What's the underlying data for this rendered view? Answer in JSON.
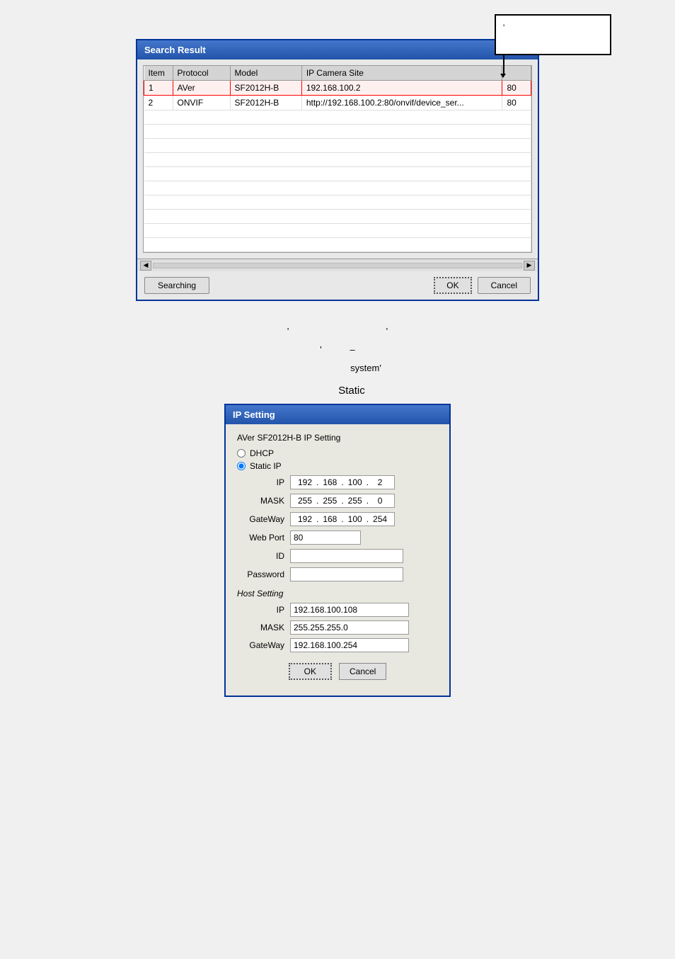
{
  "page": {
    "title": "Search Result and IP Setting UI"
  },
  "callout": {
    "text": "'"
  },
  "search_dialog": {
    "title": "Search Result",
    "columns": [
      "Item",
      "Protocol",
      "Model",
      "IP Camera Site",
      ""
    ],
    "rows": [
      {
        "item": "1",
        "protocol": "AVer",
        "model": "SF2012H-B",
        "ip": "192.168.100.2",
        "port": "80",
        "selected": true
      },
      {
        "item": "2",
        "protocol": "ONVIF",
        "model": "SF2012H-B",
        "ip": "http://192.168.100.2:80/onvif/device_ser...",
        "port": "80",
        "selected": false
      }
    ],
    "empty_rows": 10,
    "searching_btn": "Searching",
    "ok_btn": "OK",
    "cancel_btn": "Cancel"
  },
  "middle_text": {
    "line1": "' , '",
    "line2": "' –",
    "line3": "system'"
  },
  "static_text": "Static",
  "ip_dialog": {
    "title": "IP Setting",
    "device_label": "AVer SF2012H-B IP Setting",
    "dhcp_label": "DHCP",
    "static_ip_label": "Static IP",
    "static_ip_selected": true,
    "ip_label": "IP",
    "ip_octets": [
      "192",
      "168",
      "100",
      "2"
    ],
    "mask_label": "MASK",
    "mask_octets": [
      "255",
      "255",
      "255",
      "0"
    ],
    "gateway_label": "GateWay",
    "gateway_octets": [
      "192",
      "168",
      "100",
      "254"
    ],
    "webport_label": "Web Port",
    "webport_value": "80",
    "id_label": "ID",
    "id_value": "",
    "password_label": "Password",
    "password_value": "",
    "host_section_label": "Host Setting",
    "host_ip_label": "IP",
    "host_ip_value": "192.168.100.108",
    "host_mask_label": "MASK",
    "host_mask_value": "255.255.255.0",
    "host_gateway_label": "GateWay",
    "host_gateway_value": "192.168.100.254",
    "ok_btn": "OK",
    "cancel_btn": "Cancel"
  }
}
